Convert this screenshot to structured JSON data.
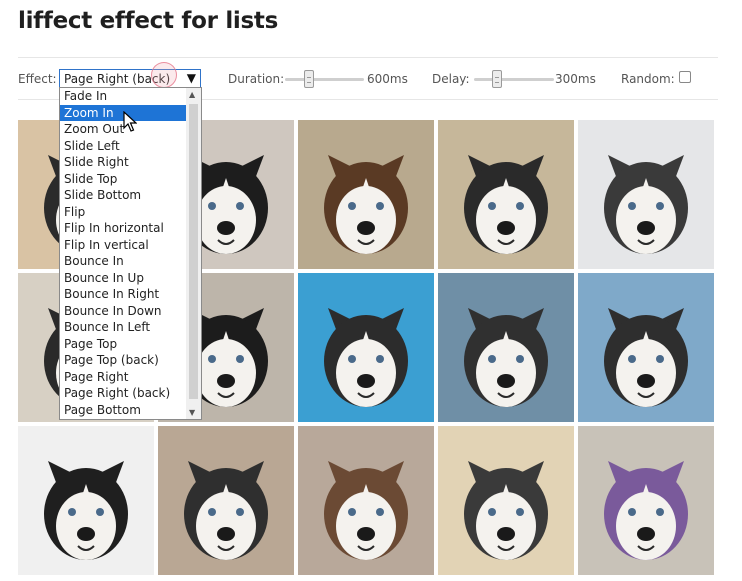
{
  "page": {
    "title": "liffect effect for lists"
  },
  "controls": {
    "effect_label": "Effect:",
    "effect_value": "Page Right (back)",
    "duration_label": "Duration:",
    "duration_value": "600ms",
    "duration_level": 0.28,
    "delay_label": "Delay:",
    "delay_value": "300ms",
    "delay_level": 0.25,
    "random_label": "Random:",
    "random_checked": false
  },
  "dropdown": {
    "selected_index": 1,
    "options": [
      "Fade In",
      "Zoom In",
      "Zoom Out",
      "Slide Left",
      "Slide Right",
      "Slide Top",
      "Slide Bottom",
      "Flip",
      "Flip In horizontal",
      "Flip In vertical",
      "Bounce In",
      "Bounce In Up",
      "Bounce In Right",
      "Bounce In Down",
      "Bounce In Left",
      "Page Top",
      "Page Top (back)",
      "Page Right",
      "Page Right (back)",
      "Page Bottom"
    ]
  },
  "icons": {
    "dropdown_arrow": "triangle-down-icon",
    "cursor": "mouse-pointer-icon"
  },
  "grid": {
    "tiles": [
      {
        "bg": "#d9c3a4",
        "fur": "#2b2b2b"
      },
      {
        "bg": "#cfc7bf",
        "fur": "#1d1d1d"
      },
      {
        "bg": "#b8a98e",
        "fur": "#5a3a24"
      },
      {
        "bg": "#c6b79a",
        "fur": "#2a2a2a"
      },
      {
        "bg": "#e5e6e8",
        "fur": "#3a3a3a"
      },
      {
        "bg": "#d7d0c4",
        "fur": "#2a2a2a"
      },
      {
        "bg": "#bdb5aa",
        "fur": "#1c1c1c"
      },
      {
        "bg": "#3b9fd2",
        "fur": "#2c2c2c"
      },
      {
        "bg": "#6f8fa6",
        "fur": "#303030"
      },
      {
        "bg": "#7fa9c9",
        "fur": "#2e2e2e"
      },
      {
        "bg": "#f0f0f0",
        "fur": "#1f1f1f"
      },
      {
        "bg": "#b9a794",
        "fur": "#2f2f2f"
      },
      {
        "bg": "#b8a89a",
        "fur": "#6b4a34"
      },
      {
        "bg": "#e2d3b5",
        "fur": "#3a3a3a"
      },
      {
        "bg": "#c8c2b8",
        "fur": "#7a5a9b"
      }
    ]
  }
}
